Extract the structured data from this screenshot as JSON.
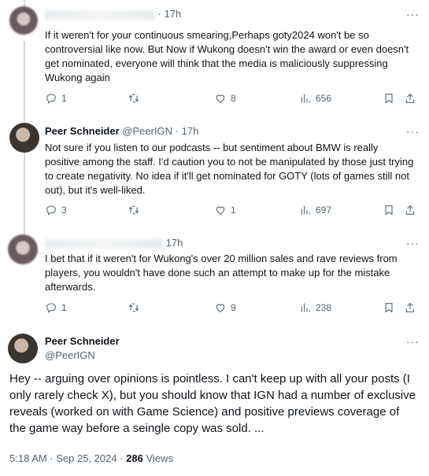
{
  "tweets": [
    {
      "name": "",
      "handle": "",
      "time": "· 17h",
      "text": "If it weren't for your continuous smearing,Perhaps goty2024 won't be so controversial like now. But Now if Wukong doesn't win the award or even doesn't get nominated, everyone will think that the media is maliciously suppressing Wukong again",
      "replies": "1",
      "retweets": "",
      "likes": "8",
      "views": "656"
    },
    {
      "name": "Peer Schneider",
      "handle": "@PeerIGN · 17h",
      "time": "",
      "text": "Not sure if you listen to our podcasts -- but sentiment about BMW is really positive among the staff. I'd caution you to not be manipulated by those just trying to create negativity. No idea if it'll get nominated for GOTY (lots of games still not out), but it's well-liked.",
      "replies": "3",
      "retweets": "",
      "likes": "1",
      "views": "697"
    },
    {
      "name": "",
      "handle": "",
      "time": "17h",
      "text": "I bet that if it weren't for Wukong's over 20 million sales and rave reviews from players, you wouldn't have done such an attempt to make up for the mistake afterwards.",
      "replies": "1",
      "retweets": "",
      "likes": "9",
      "views": "238"
    }
  ],
  "focal": {
    "name": "Peer Schneider",
    "handle": "@PeerIGN",
    "text": "Hey -- arguing over opinions is pointless. I can't keep up with all your posts (I only rarely check X), but you should know that IGN had a number of exclusive reveals (worked on with Game Science) and positive previews coverage of the game way before a seingle copy was sold. ...",
    "time": "5:18 AM · Sep 25, 2024 ·",
    "views_count": "286",
    "views_label": "Views"
  },
  "more_label": "···",
  "icons": [
    "reply-icon",
    "retweet-icon",
    "like-icon",
    "views-icon",
    "bookmark-icon",
    "share-icon",
    "more-icon"
  ],
  "colors": {
    "text": "#0f1419",
    "secondary": "#536471",
    "thread_line": "#cfd9de"
  }
}
